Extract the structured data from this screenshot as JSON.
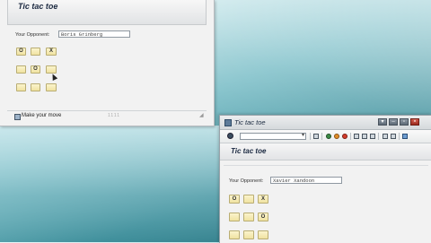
{
  "window1": {
    "title": "Tic tac toe",
    "opponent_label": "Your Opponent:",
    "opponent_value": "Boris Grinberg",
    "board": [
      [
        "O",
        "",
        "X"
      ],
      [
        "",
        "O",
        ""
      ],
      [
        "",
        "",
        ""
      ]
    ],
    "status_text": "Make your move",
    "status_mark": "1111"
  },
  "window2": {
    "title": "Tic tac toe",
    "header_title": "Tic tac toe",
    "opponent_label": "Your Opponent:",
    "opponent_value": "Xavier Xandoon",
    "board": [
      [
        "O",
        "",
        "X"
      ],
      [
        "",
        "",
        "O"
      ],
      [
        "",
        "",
        ""
      ]
    ],
    "icons": [
      "check-icon",
      "back-icon",
      "exit-icon",
      "cancel-icon",
      "print-icon",
      "find-icon",
      "find-next-icon",
      "new-session-icon",
      "layout-icon",
      "help-icon"
    ]
  },
  "colors": {
    "cell_fill": "#f0e2a1",
    "title_text": "#1b2940",
    "desktop": "#3f8f9b"
  }
}
